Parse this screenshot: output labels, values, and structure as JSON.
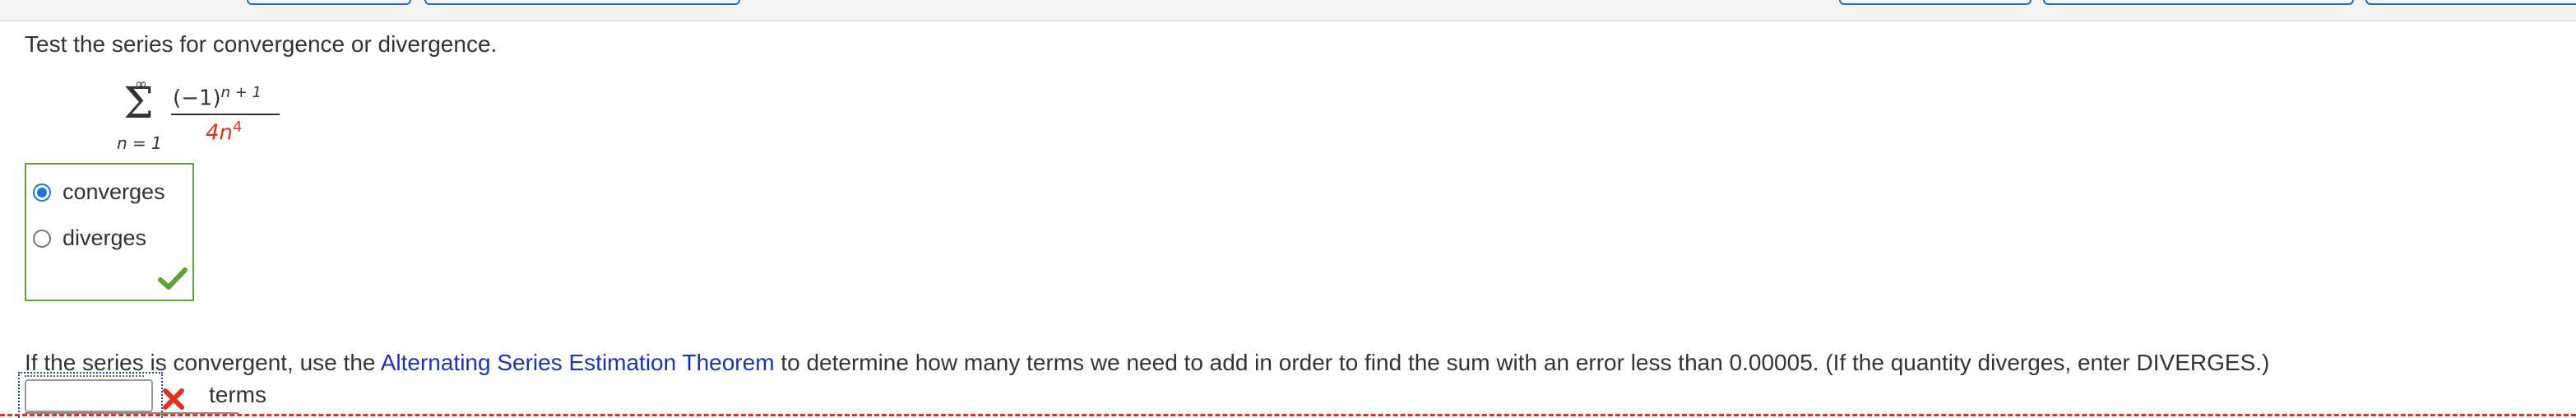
{
  "question": {
    "prompt": "Test the series for convergence or divergence."
  },
  "series": {
    "sum_upper": "∞",
    "sum_lower": "n = 1",
    "numerator_base": "(−1)",
    "numerator_exponent": "n + 1",
    "denominator_coefficient": "4n",
    "denominator_exponent": "4"
  },
  "choices": {
    "options": [
      {
        "label": "converges",
        "selected": true
      },
      {
        "label": "diverges",
        "selected": false
      }
    ],
    "status": "correct"
  },
  "followup": {
    "prefix_dotted": "If the series",
    "text_before_link": " is convergent, use the ",
    "link_text": "Alternating Series Estimation Theorem",
    "text_after_link": " to determine how many terms we need to add in order to find the sum with an error less than 0.00005. (If the quantity diverges, enter DIVERGES.)",
    "input_value": "",
    "input_status": "incorrect",
    "unit_label": "terms"
  },
  "colors": {
    "link": "#1a33b5",
    "correct": "#5fa33a",
    "incorrect": "#e0301e",
    "radio_selected": "#1a73e8"
  }
}
